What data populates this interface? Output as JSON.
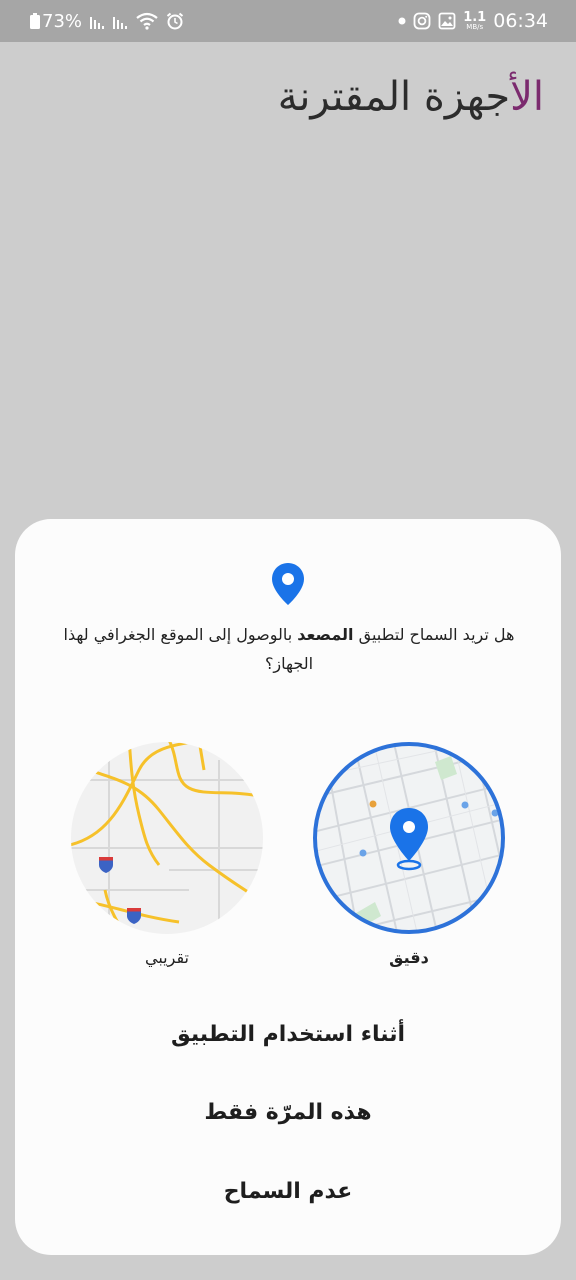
{
  "status_bar": {
    "battery": "73%",
    "network_speed_value": "1.1",
    "network_speed_unit": "MB/s",
    "time": "06:34",
    "icons": [
      "battery-icon",
      "signal-icon",
      "signal-icon",
      "wifi-icon",
      "alarm-icon",
      "notification-dot-icon",
      "instagram-icon",
      "gallery-icon"
    ]
  },
  "background_page": {
    "title_accent": "الأ",
    "title_rest": "جهزة المقترنة"
  },
  "dialog": {
    "prompt_before": "هل تريد السماح لتطبيق ",
    "app_name": "المصعد",
    "prompt_after": " بالوصول إلى الموقع الجغرافي لهذا الجهاز؟",
    "precise_label": "دقيق",
    "approximate_label": "تقريبي",
    "buttons": {
      "while_using": "أثناء استخدام التطبيق",
      "only_this_time": "هذه المرّة فقط",
      "deny": "عدم السماح"
    }
  },
  "colors": {
    "accent_blue": "#1a73e8",
    "selected_ring": "#2d72d9",
    "map_road_yellow": "#f6c12a",
    "title_accent": "#7b2a6e"
  }
}
